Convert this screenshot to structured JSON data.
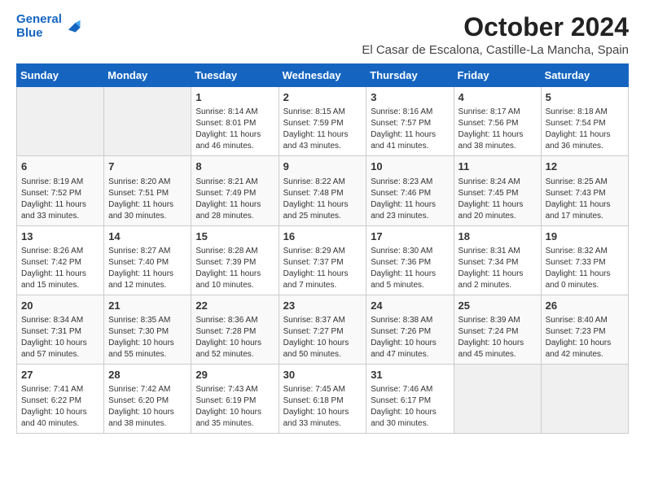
{
  "header": {
    "logo_line1": "General",
    "logo_line2": "Blue",
    "title": "October 2024",
    "subtitle": "El Casar de Escalona, Castille-La Mancha, Spain"
  },
  "days_of_week": [
    "Sunday",
    "Monday",
    "Tuesday",
    "Wednesday",
    "Thursday",
    "Friday",
    "Saturday"
  ],
  "weeks": [
    [
      {
        "day": "",
        "info": ""
      },
      {
        "day": "",
        "info": ""
      },
      {
        "day": "1",
        "info": "Sunrise: 8:14 AM\nSunset: 8:01 PM\nDaylight: 11 hours and 46 minutes."
      },
      {
        "day": "2",
        "info": "Sunrise: 8:15 AM\nSunset: 7:59 PM\nDaylight: 11 hours and 43 minutes."
      },
      {
        "day": "3",
        "info": "Sunrise: 8:16 AM\nSunset: 7:57 PM\nDaylight: 11 hours and 41 minutes."
      },
      {
        "day": "4",
        "info": "Sunrise: 8:17 AM\nSunset: 7:56 PM\nDaylight: 11 hours and 38 minutes."
      },
      {
        "day": "5",
        "info": "Sunrise: 8:18 AM\nSunset: 7:54 PM\nDaylight: 11 hours and 36 minutes."
      }
    ],
    [
      {
        "day": "6",
        "info": "Sunrise: 8:19 AM\nSunset: 7:52 PM\nDaylight: 11 hours and 33 minutes."
      },
      {
        "day": "7",
        "info": "Sunrise: 8:20 AM\nSunset: 7:51 PM\nDaylight: 11 hours and 30 minutes."
      },
      {
        "day": "8",
        "info": "Sunrise: 8:21 AM\nSunset: 7:49 PM\nDaylight: 11 hours and 28 minutes."
      },
      {
        "day": "9",
        "info": "Sunrise: 8:22 AM\nSunset: 7:48 PM\nDaylight: 11 hours and 25 minutes."
      },
      {
        "day": "10",
        "info": "Sunrise: 8:23 AM\nSunset: 7:46 PM\nDaylight: 11 hours and 23 minutes."
      },
      {
        "day": "11",
        "info": "Sunrise: 8:24 AM\nSunset: 7:45 PM\nDaylight: 11 hours and 20 minutes."
      },
      {
        "day": "12",
        "info": "Sunrise: 8:25 AM\nSunset: 7:43 PM\nDaylight: 11 hours and 17 minutes."
      }
    ],
    [
      {
        "day": "13",
        "info": "Sunrise: 8:26 AM\nSunset: 7:42 PM\nDaylight: 11 hours and 15 minutes."
      },
      {
        "day": "14",
        "info": "Sunrise: 8:27 AM\nSunset: 7:40 PM\nDaylight: 11 hours and 12 minutes."
      },
      {
        "day": "15",
        "info": "Sunrise: 8:28 AM\nSunset: 7:39 PM\nDaylight: 11 hours and 10 minutes."
      },
      {
        "day": "16",
        "info": "Sunrise: 8:29 AM\nSunset: 7:37 PM\nDaylight: 11 hours and 7 minutes."
      },
      {
        "day": "17",
        "info": "Sunrise: 8:30 AM\nSunset: 7:36 PM\nDaylight: 11 hours and 5 minutes."
      },
      {
        "day": "18",
        "info": "Sunrise: 8:31 AM\nSunset: 7:34 PM\nDaylight: 11 hours and 2 minutes."
      },
      {
        "day": "19",
        "info": "Sunrise: 8:32 AM\nSunset: 7:33 PM\nDaylight: 11 hours and 0 minutes."
      }
    ],
    [
      {
        "day": "20",
        "info": "Sunrise: 8:34 AM\nSunset: 7:31 PM\nDaylight: 10 hours and 57 minutes."
      },
      {
        "day": "21",
        "info": "Sunrise: 8:35 AM\nSunset: 7:30 PM\nDaylight: 10 hours and 55 minutes."
      },
      {
        "day": "22",
        "info": "Sunrise: 8:36 AM\nSunset: 7:28 PM\nDaylight: 10 hours and 52 minutes."
      },
      {
        "day": "23",
        "info": "Sunrise: 8:37 AM\nSunset: 7:27 PM\nDaylight: 10 hours and 50 minutes."
      },
      {
        "day": "24",
        "info": "Sunrise: 8:38 AM\nSunset: 7:26 PM\nDaylight: 10 hours and 47 minutes."
      },
      {
        "day": "25",
        "info": "Sunrise: 8:39 AM\nSunset: 7:24 PM\nDaylight: 10 hours and 45 minutes."
      },
      {
        "day": "26",
        "info": "Sunrise: 8:40 AM\nSunset: 7:23 PM\nDaylight: 10 hours and 42 minutes."
      }
    ],
    [
      {
        "day": "27",
        "info": "Sunrise: 7:41 AM\nSunset: 6:22 PM\nDaylight: 10 hours and 40 minutes."
      },
      {
        "day": "28",
        "info": "Sunrise: 7:42 AM\nSunset: 6:20 PM\nDaylight: 10 hours and 38 minutes."
      },
      {
        "day": "29",
        "info": "Sunrise: 7:43 AM\nSunset: 6:19 PM\nDaylight: 10 hours and 35 minutes."
      },
      {
        "day": "30",
        "info": "Sunrise: 7:45 AM\nSunset: 6:18 PM\nDaylight: 10 hours and 33 minutes."
      },
      {
        "day": "31",
        "info": "Sunrise: 7:46 AM\nSunset: 6:17 PM\nDaylight: 10 hours and 30 minutes."
      },
      {
        "day": "",
        "info": ""
      },
      {
        "day": "",
        "info": ""
      }
    ]
  ]
}
